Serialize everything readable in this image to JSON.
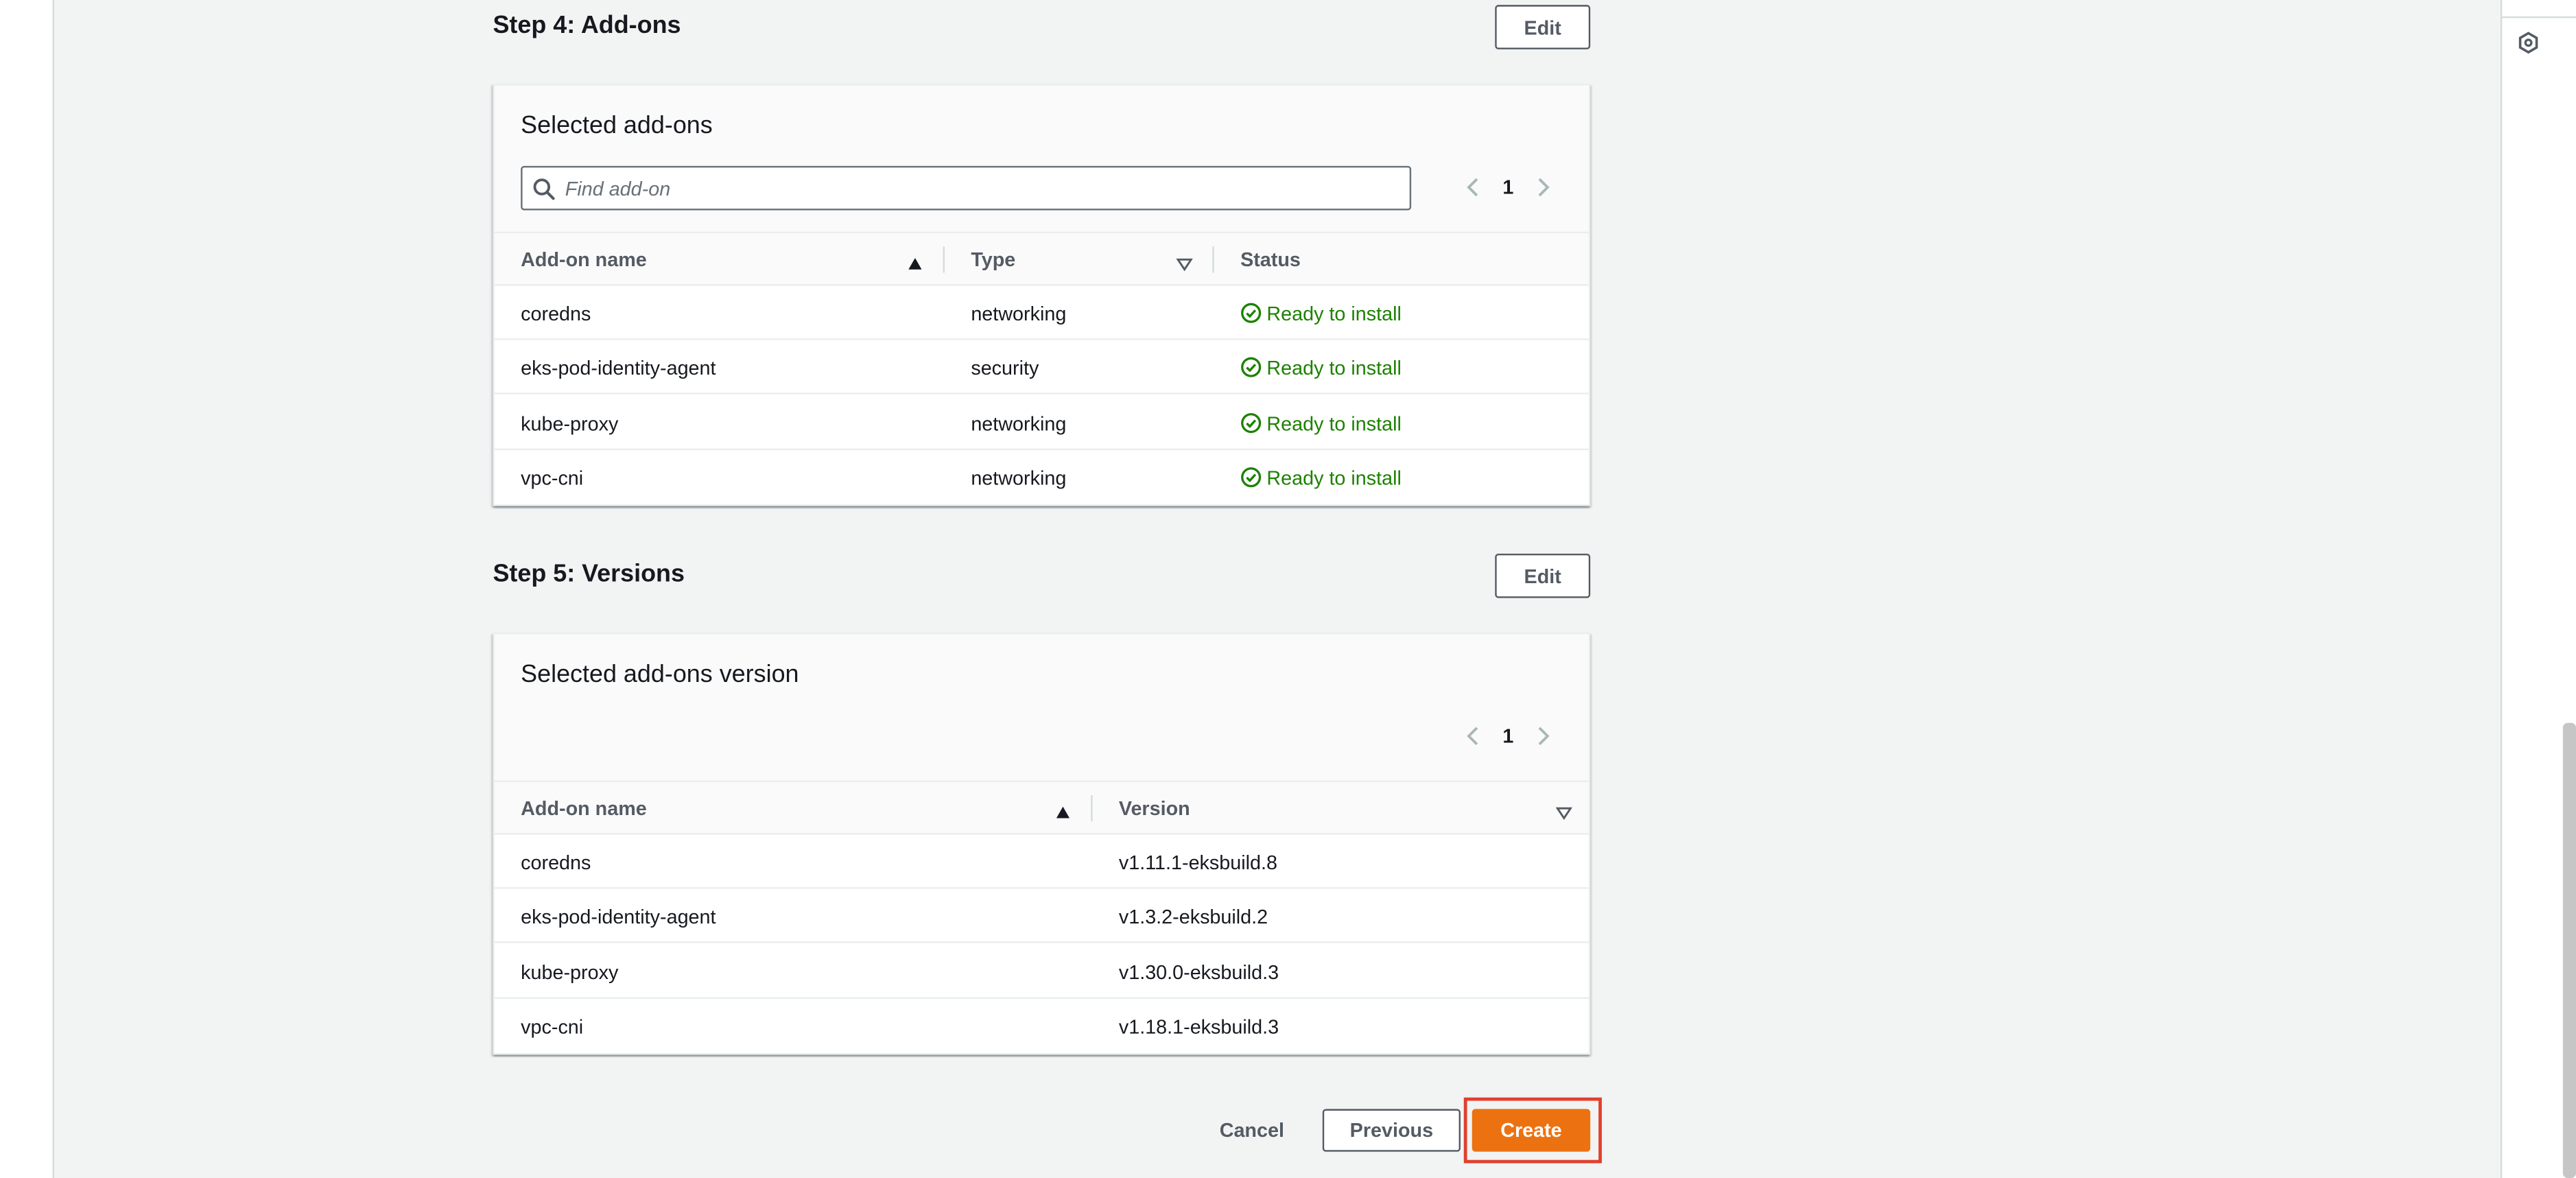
{
  "step4": {
    "title": "Step 4: Add-ons",
    "edit_label": "Edit",
    "card_title": "Selected add-ons",
    "search_placeholder": "Find add-on",
    "page": "1",
    "columns": {
      "name": "Add-on name",
      "type": "Type",
      "status": "Status"
    },
    "rows": [
      {
        "name": "coredns",
        "type": "networking",
        "status": "Ready to install"
      },
      {
        "name": "eks-pod-identity-agent",
        "type": "security",
        "status": "Ready to install"
      },
      {
        "name": "kube-proxy",
        "type": "networking",
        "status": "Ready to install"
      },
      {
        "name": "vpc-cni",
        "type": "networking",
        "status": "Ready to install"
      }
    ]
  },
  "step5": {
    "title": "Step 5: Versions",
    "edit_label": "Edit",
    "card_title": "Selected add-ons version",
    "page": "1",
    "columns": {
      "name": "Add-on name",
      "version": "Version"
    },
    "rows": [
      {
        "name": "coredns",
        "version": "v1.11.1-eksbuild.8"
      },
      {
        "name": "eks-pod-identity-agent",
        "version": "v1.3.2-eksbuild.2"
      },
      {
        "name": "kube-proxy",
        "version": "v1.30.0-eksbuild.3"
      },
      {
        "name": "vpc-cni",
        "version": "v1.18.1-eksbuild.3"
      }
    ]
  },
  "footer": {
    "cancel_label": "Cancel",
    "previous_label": "Previous",
    "create_label": "Create"
  },
  "icons": {
    "search": "search-icon",
    "status": "check-circle-icon",
    "sort_asc": "sort-ascending-icon",
    "sort_none": "sort-unsorted-icon",
    "prev": "chevron-left-icon",
    "next": "chevron-right-icon",
    "rail": "hexagon-settings-icon"
  },
  "colors": {
    "primary": "#ec7211",
    "success": "#1d8102",
    "highlight": "#e0402c",
    "background": "#f2f3f3"
  }
}
